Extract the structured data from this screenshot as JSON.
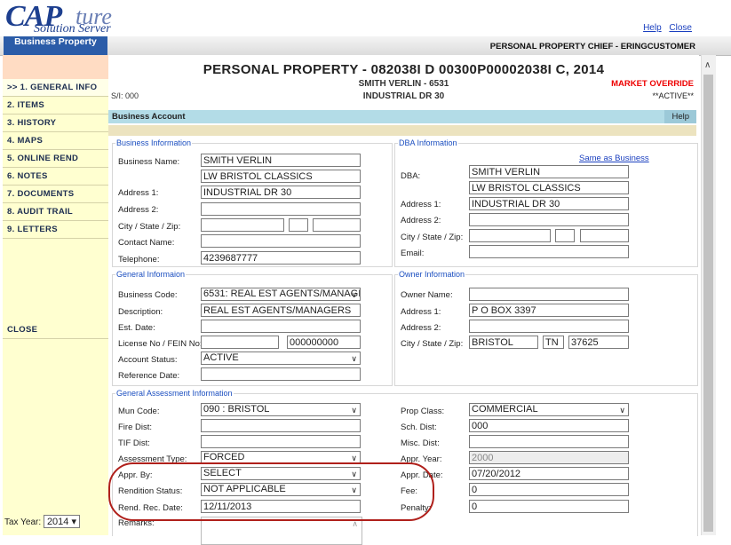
{
  "brand": {
    "cap": "CAP",
    "ture": "ture",
    "tagline": "Solution Server"
  },
  "top_links": {
    "help": "Help",
    "close": "Close"
  },
  "module_tab": "Business Property",
  "user_info": "PERSONAL PROPERTY CHIEF - ERINGCUSTOMER",
  "sidebar": {
    "items": [
      {
        "label": ">> 1. GENERAL INFO"
      },
      {
        "label": "2. ITEMS"
      },
      {
        "label": "3. HISTORY"
      },
      {
        "label": "4. MAPS"
      },
      {
        "label": "5. ONLINE REND"
      },
      {
        "label": "6. NOTES"
      },
      {
        "label": "7. DOCUMENTS"
      },
      {
        "label": "8. AUDIT TRAIL"
      },
      {
        "label": "9. LETTERS"
      }
    ],
    "close_label": "CLOSE",
    "tax_year_label": "Tax Year:",
    "tax_year_value": "2014"
  },
  "header": {
    "title": "PERSONAL PROPERTY - 082038I D 00300P00002038I C, 2014",
    "owner_line": "SMITH VERLIN - 6531",
    "address_line": "INDUSTRIAL DR 30",
    "sl": "S/I: 000",
    "market_override": "MARKET OVERRIDE",
    "status": "**ACTIVE**"
  },
  "section_bar": {
    "title": "Business Account",
    "help": "Help"
  },
  "business_info": {
    "legend": "Business Information",
    "labels": {
      "name": "Business Name:",
      "addr1": "Address 1:",
      "addr2": "Address 2:",
      "csz": "City / State / Zip:",
      "contact": "Contact Name:",
      "phone": "Telephone:"
    },
    "name1": "SMITH VERLIN",
    "name2": "LW BRISTOL CLASSICS",
    "address1": "INDUSTRIAL DR 30",
    "address2": "",
    "city": "",
    "state": "",
    "zip": "",
    "contact": "",
    "telephone": "4239687777"
  },
  "dba_info": {
    "legend": "DBA Information",
    "same_as": "Same as Business",
    "labels": {
      "dba": "DBA:",
      "addr1": "Address 1:",
      "addr2": "Address 2:",
      "csz": "City / State / Zip:",
      "email": "Email:"
    },
    "dba1": "SMITH VERLIN",
    "dba2": "LW BRISTOL CLASSICS",
    "address1": "INDUSTRIAL DR 30",
    "address2": "",
    "city": "",
    "state": "",
    "zip": "",
    "email": ""
  },
  "general_info": {
    "legend": "General Informaion",
    "labels": {
      "code": "Business Code:",
      "desc": "Description:",
      "est": "Est. Date:",
      "license": "License No / FEIN No:",
      "status": "Account Status:",
      "ref": "Reference Date:"
    },
    "business_code": "6531: REAL EST AGENTS/MANAGI",
    "description": "REAL EST AGENTS/MANAGERS",
    "est_date": "",
    "license_no": "",
    "fein_no": "000000000",
    "account_status": "ACTIVE",
    "reference_date": ""
  },
  "owner_info": {
    "legend": "Owner Information",
    "labels": {
      "name": "Owner Name:",
      "addr1": "Address 1:",
      "addr2": "Address 2:",
      "csz": "City / State / Zip:"
    },
    "owner_name": "",
    "address1": "P O BOX 3397",
    "address2": "",
    "city": "BRISTOL",
    "state": "TN",
    "zip": "37625"
  },
  "assessment": {
    "legend": "General Assessment Information",
    "labels": {
      "mun": "Mun Code:",
      "fire": "Fire Dist:",
      "tif": "TIF Dist:",
      "atype": "Assessment Type:",
      "appr_by": "Appr. By:",
      "rend_status": "Rendition Status:",
      "rend_date": "Rend. Rec. Date:",
      "remarks": "Remarks:",
      "prop_class": "Prop Class:",
      "sch": "Sch. Dist:",
      "misc": "Misc. Dist:",
      "appr_year": "Appr. Year:",
      "appr_date": "Appr. Date:",
      "fee": "Fee:",
      "penalty": "Penalty:"
    },
    "mun_code": "090 : BRISTOL",
    "fire_dist": "",
    "tif_dist": "",
    "assessment_type": "FORCED",
    "appr_by": "SELECT",
    "rendition_status": "NOT APPLICABLE",
    "rend_rec_date": "12/11/2013",
    "remarks": "",
    "prop_class": "COMMERCIAL",
    "sch_dist": "000",
    "misc_dist": "",
    "appr_year": "2000",
    "appr_date": "07/20/2012",
    "fee": "0",
    "penalty": "0"
  }
}
